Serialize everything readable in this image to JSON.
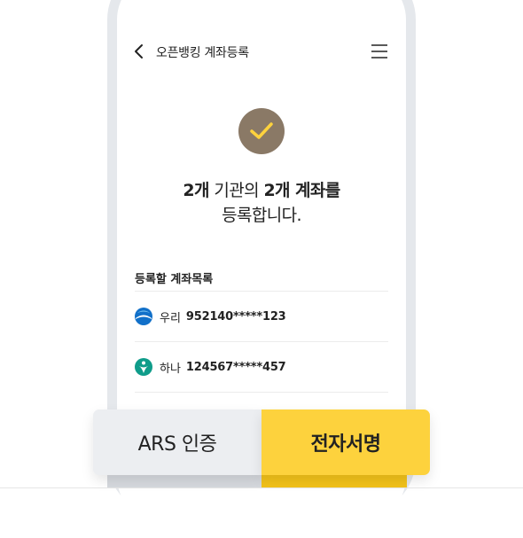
{
  "header": {
    "title": "오픈뱅킹 계좌등록"
  },
  "message": {
    "part1": "2개",
    "part2": " 기관의 ",
    "part3": "2개 계좌를",
    "line2": "등록합니다."
  },
  "list": {
    "title": "등록할 계좌목록",
    "accounts": [
      {
        "bank": "우리",
        "number": "952140*****123",
        "logo": "woori-bank-icon"
      },
      {
        "bank": "하나",
        "number": "124567*****457",
        "logo": "hana-bank-icon"
      }
    ]
  },
  "buttons": {
    "ars": "ARS 인증",
    "sign": "전자서명"
  },
  "colors": {
    "accent_yellow": "#fdd23d",
    "check_circle": "#8a7966",
    "check_mark": "#fdd23d",
    "woori_blue": "#1170c9",
    "hana_teal": "#0f9c8a",
    "frame_gray": "#e5e8ec"
  }
}
